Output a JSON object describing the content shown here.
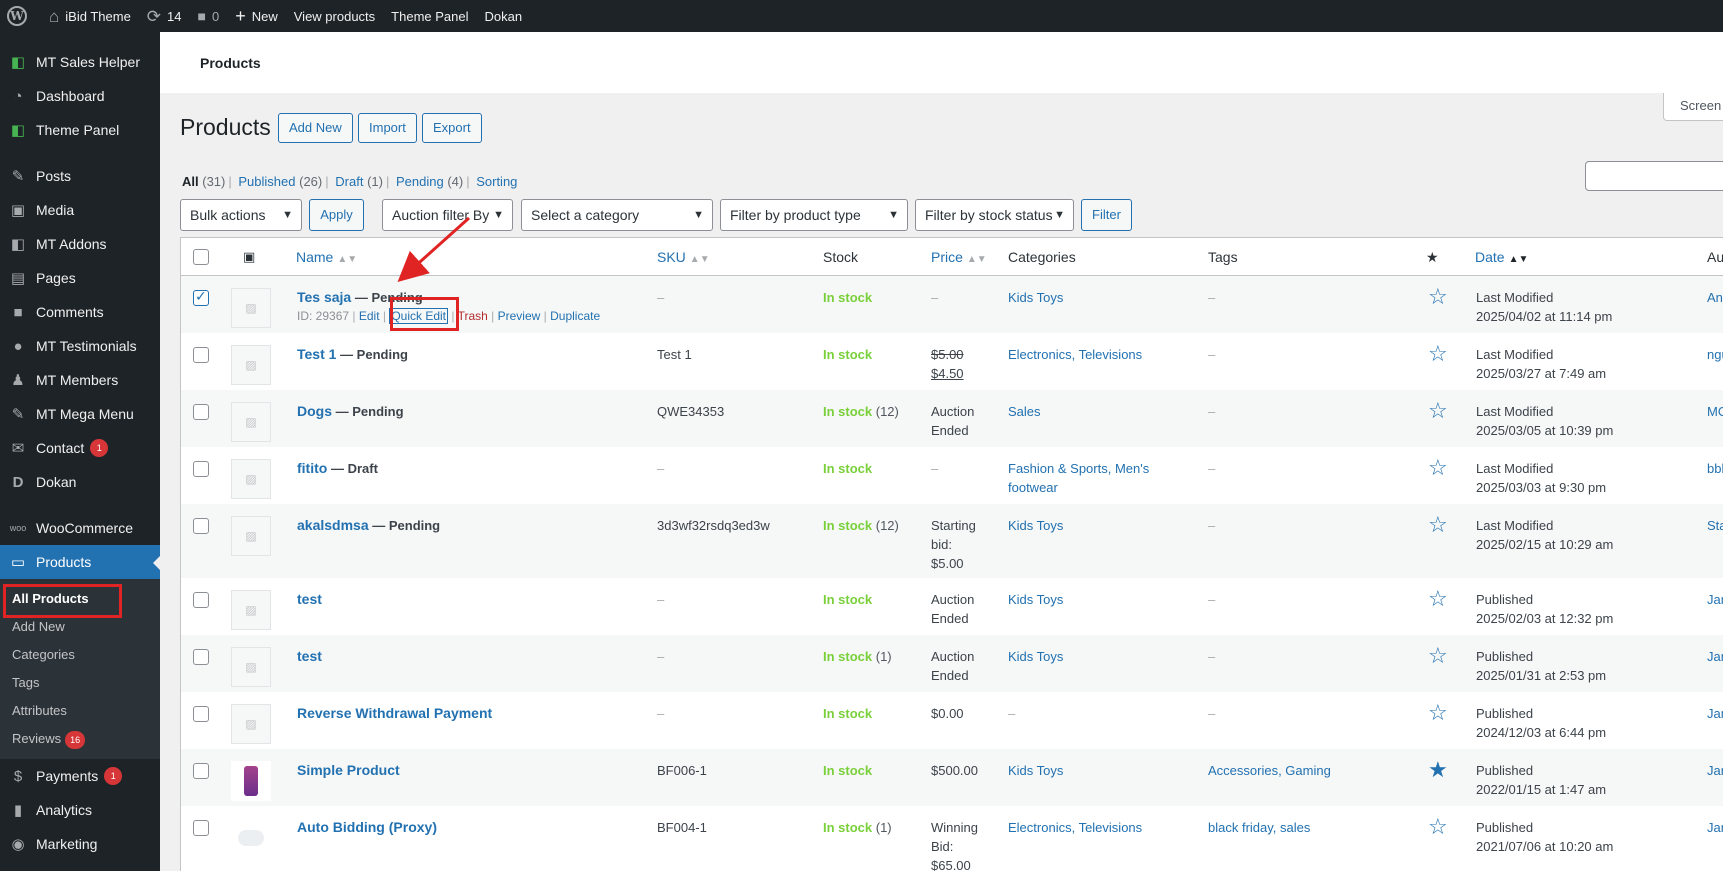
{
  "adminbar": {
    "site_name": "iBid Theme",
    "updates_count": "14",
    "comments_count": "0",
    "new_label": "New",
    "view_products": "View products",
    "theme_panel": "Theme Panel",
    "dokan": "Dokan"
  },
  "sidebar": {
    "items": [
      {
        "label": "MT Sales Helper",
        "icon": "mt-icon"
      },
      {
        "label": "Dashboard",
        "icon": "dashboard-icon"
      },
      {
        "label": "Theme Panel",
        "icon": "mt-icon"
      },
      {
        "label": "Posts",
        "icon": "pin-icon"
      },
      {
        "label": "Media",
        "icon": "media-icon"
      },
      {
        "label": "MT Addons",
        "icon": "mt-icon"
      },
      {
        "label": "Pages",
        "icon": "pages-icon"
      },
      {
        "label": "Comments",
        "icon": "comment-icon"
      },
      {
        "label": "MT Testimonials",
        "icon": "testimonial-icon"
      },
      {
        "label": "MT Members",
        "icon": "user-icon"
      },
      {
        "label": "MT Mega Menu",
        "icon": "pin-icon"
      },
      {
        "label": "Contact",
        "badge": "1",
        "icon": "mail-icon"
      },
      {
        "label": "Dokan",
        "icon": "dokan-icon"
      },
      {
        "label": "WooCommerce",
        "icon": "woo-icon"
      },
      {
        "label": "Products",
        "icon": "products-icon"
      },
      {
        "label": "Payments",
        "badge": "1",
        "icon": "payments-icon"
      },
      {
        "label": "Analytics",
        "icon": "analytics-icon"
      },
      {
        "label": "Marketing",
        "icon": "marketing-icon"
      }
    ],
    "submenu": [
      {
        "label": "All Products"
      },
      {
        "label": "Add New"
      },
      {
        "label": "Categories"
      },
      {
        "label": "Tags"
      },
      {
        "label": "Attributes"
      },
      {
        "label": "Reviews",
        "badge": "16"
      }
    ]
  },
  "header": {
    "breadcrumb": "Products",
    "screen_options": "Screen Options"
  },
  "page": {
    "title": "Products",
    "add_new": "Add New",
    "import": "Import",
    "export": "Export"
  },
  "status": {
    "all": "All",
    "all_count": "(31)",
    "published": "Published",
    "published_count": "(26)",
    "draft": "Draft",
    "draft_count": "(1)",
    "pending": "Pending",
    "pending_count": "(4)",
    "sorting": "Sorting"
  },
  "filters": {
    "bulk_actions": "Bulk actions",
    "apply": "Apply",
    "auction_filter": "Auction filter By",
    "category": "Select a category",
    "product_type": "Filter by product type",
    "stock_status": "Filter by stock status",
    "filter": "Filter"
  },
  "table": {
    "columns": {
      "name": "Name",
      "sku": "SKU",
      "stock": "Stock",
      "price": "Price",
      "categories": "Categories",
      "tags": "Tags",
      "date": "Date",
      "author": "Au"
    },
    "row_actions": {
      "id": "ID: 29367",
      "edit": "Edit",
      "quick_edit": "Quick Edit",
      "trash": "Trash",
      "preview": "Preview",
      "duplicate": "Duplicate"
    },
    "rows": [
      {
        "name": "Tes saja",
        "state": "— Pending",
        "sku": "–",
        "stock": "In stock",
        "stock_n": "",
        "price1": "–",
        "price2": "",
        "price3": "",
        "categories1": "Kids Toys",
        "categories2": "",
        "tags": "–",
        "date1": "Last Modified",
        "date2": "2025/04/02 at 11:14 pm",
        "author": "Any",
        "checked": true,
        "featured": false
      },
      {
        "name": "Test 1",
        "state": "— Pending",
        "sku": "Test 1",
        "stock": "In stock",
        "stock_n": "",
        "price1": "$5.00",
        "price2": "$4.50",
        "price3": "",
        "categories1": "Electronics, Televisions",
        "categories2": "",
        "tags": "–",
        "date1": "Last Modified",
        "date2": "2025/03/27 at 7:49 am",
        "author": "ngu",
        "checked": false,
        "featured": false
      },
      {
        "name": "Dogs",
        "state": "— Pending",
        "sku": "QWE34353",
        "stock": "In stock",
        "stock_n": "(12)",
        "price1": "Auction",
        "price2": "Ended",
        "price3": "",
        "categories1": "Sales",
        "categories2": "",
        "tags": "–",
        "date1": "Last Modified",
        "date2": "2025/03/05 at 10:39 pm",
        "author": "MO",
        "checked": false,
        "featured": false
      },
      {
        "name": "fitito",
        "state": "— Draft",
        "sku": "–",
        "stock": "In stock",
        "stock_n": "",
        "price1": "–",
        "price2": "",
        "price3": "",
        "categories1": "Fashion & Sports, Men's",
        "categories2": "footwear",
        "tags": "–",
        "date1": "Last Modified",
        "date2": "2025/03/03 at 9:30 pm",
        "author": "bbb",
        "checked": false,
        "featured": false
      },
      {
        "name": "akalsdmsa",
        "state": "— Pending",
        "sku": "3d3wf32rsdq3ed3w",
        "stock": "In stock",
        "stock_n": "(12)",
        "price1": "Starting",
        "price2": "bid:",
        "price3": "$5.00",
        "categories1": "Kids Toys",
        "categories2": "",
        "tags": "–",
        "date1": "Last Modified",
        "date2": "2025/02/15 at 10:29 am",
        "author": "Sta",
        "checked": false,
        "featured": false
      },
      {
        "name": "test",
        "state": "",
        "sku": "–",
        "stock": "In stock",
        "stock_n": "",
        "price1": "Auction",
        "price2": "Ended",
        "price3": "",
        "categories1": "Kids Toys",
        "categories2": "",
        "tags": "–",
        "date1": "Published",
        "date2": "2025/02/03 at 12:32 pm",
        "author": "Jan",
        "checked": false,
        "featured": false
      },
      {
        "name": "test",
        "state": "",
        "sku": "–",
        "stock": "In stock",
        "stock_n": "(1)",
        "price1": "Auction",
        "price2": "Ended",
        "price3": "",
        "categories1": "Kids Toys",
        "categories2": "",
        "tags": "–",
        "date1": "Published",
        "date2": "2025/01/31 at 2:53 pm",
        "author": "Jan",
        "checked": false,
        "featured": false
      },
      {
        "name": "Reverse Withdrawal Payment",
        "state": "",
        "sku": "–",
        "stock": "In stock",
        "stock_n": "",
        "price1": "$0.00",
        "price2": "",
        "price3": "",
        "categories1": "–",
        "categories2": "",
        "tags": "–",
        "date1": "Published",
        "date2": "2024/12/03 at 6:44 pm",
        "author": "Jan",
        "checked": false,
        "featured": false
      },
      {
        "name": "Simple Product",
        "state": "",
        "sku": "BF006-1",
        "stock": "In stock",
        "stock_n": "",
        "price1": "$500.00",
        "price2": "",
        "price3": "",
        "categories1": "Kids Toys",
        "categories2": "",
        "tags": "Accessories, Gaming",
        "date1": "Published",
        "date2": "2022/01/15 at 1:47 am",
        "author": "Jan",
        "checked": false,
        "featured": true
      },
      {
        "name": "Auto Bidding (Proxy)",
        "state": "",
        "sku": "BF004-1",
        "stock": "In stock",
        "stock_n": "(1)",
        "price1": "Winning",
        "price2": "Bid:",
        "price3": "$65.00",
        "categories1": "Electronics, Televisions",
        "categories2": "",
        "tags": "black friday, sales",
        "date1": "Published",
        "date2": "2021/07/06 at 10:20 am",
        "author": "Jan",
        "checked": false,
        "featured": false
      }
    ]
  },
  "colors": {
    "accent": "#2271b1",
    "admin_dark": "#1d2327",
    "in_stock": "#7ad03a",
    "highlight": "#e02424"
  }
}
